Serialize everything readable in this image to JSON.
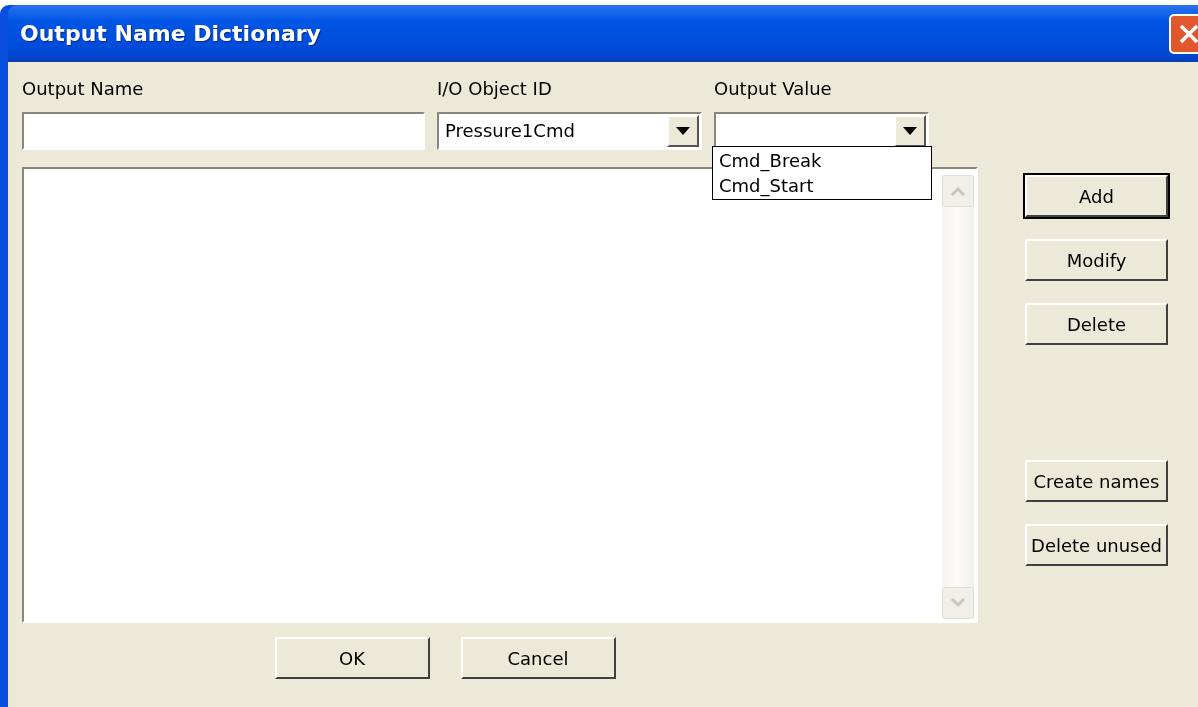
{
  "window": {
    "title": "Output Name Dictionary"
  },
  "output_name": {
    "label": "Output Name"
  },
  "io_object_id": {
    "label": "I/O Object ID",
    "value": "Pressure1Cmd"
  },
  "output_value": {
    "label": "Output Value",
    "expanded": true,
    "options": [
      "Cmd_Break",
      "Cmd_Start"
    ]
  },
  "edit_buttons": [
    {
      "label": "Add",
      "default": true
    },
    {
      "label": "Modify",
      "default": false
    },
    {
      "label": "Delete",
      "default": false
    }
  ],
  "name_buttons": [
    {
      "label": "Create names",
      "default": false
    },
    {
      "label": "Delete unused",
      "default": false
    }
  ],
  "bottom_buttons": [
    {
      "label": "OK"
    },
    {
      "label": "Cancel"
    }
  ]
}
